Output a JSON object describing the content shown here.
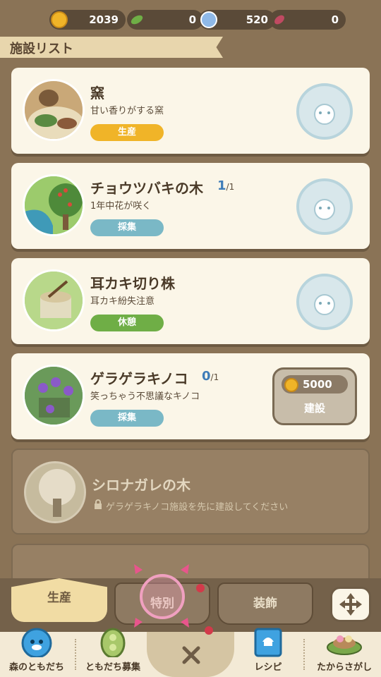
{
  "currencies": [
    {
      "icon": "gold-coin-icon",
      "value": "2039"
    },
    {
      "icon": "green-leaf-icon",
      "value": "0"
    },
    {
      "icon": "blue-gem-icon",
      "value": "520"
    },
    {
      "icon": "red-ticket-icon",
      "value": "0"
    }
  ],
  "header": {
    "title": "施設リスト"
  },
  "facilities": [
    {
      "name": "窯",
      "desc": "甘い香りがする窯",
      "badge": "生産",
      "badge_color": "#f0b428",
      "count": "",
      "total": ""
    },
    {
      "name": "チョウツバキの木",
      "desc": "1年中花が咲く",
      "badge": "採集",
      "badge_color": "#7ab8c6",
      "count": "1",
      "total": "/1"
    },
    {
      "name": "耳カキ切り株",
      "desc": "耳カキ紛失注意",
      "badge": "休憩",
      "badge_color": "#6fae46",
      "count": "",
      "total": ""
    },
    {
      "name": "ゲラゲラキノコ",
      "desc": "笑っちゃう不思議なキノコ",
      "badge": "採集",
      "badge_color": "#7ab8c6",
      "count": "0",
      "total": "/1",
      "price": "5000",
      "build_label": "建設"
    }
  ],
  "locked": {
    "name": "シロナガレの木",
    "desc": "ゲラゲラキノコ施設を先に建設してください"
  },
  "tabs": [
    {
      "label": "生産"
    },
    {
      "label": "特別"
    },
    {
      "label": "装飾"
    }
  ],
  "nav": [
    {
      "label": "森のともだち",
      "icon": "seal-friend-icon"
    },
    {
      "label": "ともだち募集",
      "icon": "bean-pod-icon"
    },
    {
      "label": "レシピ",
      "icon": "recipe-book-icon"
    },
    {
      "label": "たからさがし",
      "icon": "treasure-island-icon"
    }
  ],
  "colors": {
    "accent_pink": "#e8558c",
    "build_bg": "#c8bdaa"
  }
}
